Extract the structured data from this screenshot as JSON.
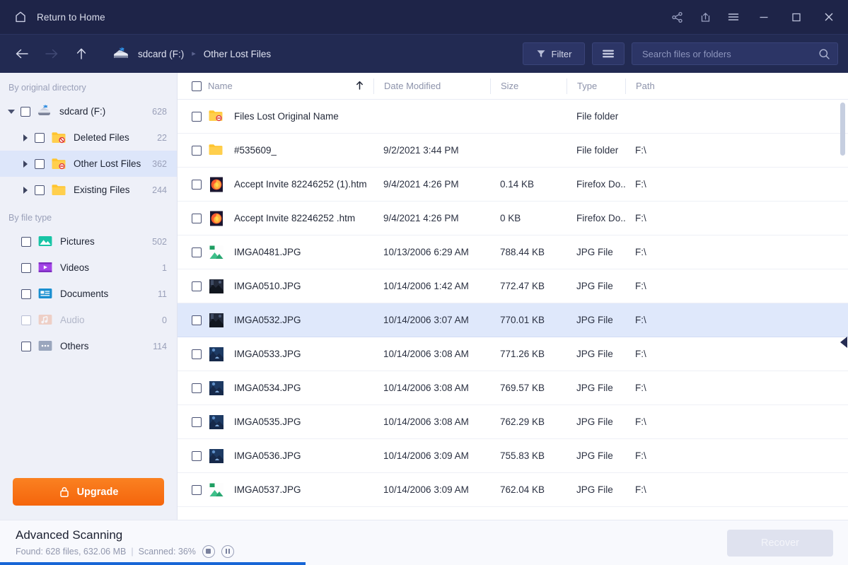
{
  "titlebar": {
    "home_label": "Return to Home",
    "home_icon": "home-icon",
    "buttons": [
      {
        "name": "share-icon",
        "label": "Share"
      },
      {
        "name": "export-icon",
        "label": "Export"
      },
      {
        "name": "menu-icon",
        "label": "Menu"
      },
      {
        "name": "minimize-icon",
        "label": "Minimize"
      },
      {
        "name": "maximize-icon",
        "label": "Maximize"
      },
      {
        "name": "close-icon",
        "label": "Close"
      }
    ]
  },
  "navbar": {
    "back_icon": "back-arrow-icon",
    "forward_icon": "forward-arrow-icon",
    "up_icon": "up-arrow-icon",
    "drive_icon": "drive-icon",
    "breadcrumb": {
      "root": "sdcard (F:)",
      "separator": "▸",
      "current": "Other Lost Files"
    },
    "filter_label": "Filter",
    "filter_icon": "funnel-icon",
    "view_icon": "list-view-icon",
    "search": {
      "placeholder": "Search files or folders",
      "value": "",
      "icon": "search-icon"
    }
  },
  "sidebar": {
    "section_directory": "By original directory",
    "section_filetype": "By file type",
    "tree": [
      {
        "label": "sdcard (F:)",
        "count": "628",
        "icon": "drive-icon",
        "level": 0,
        "expanded": true,
        "selected": false,
        "dim": false
      },
      {
        "label": "Deleted Files",
        "count": "22",
        "icon": "folder-deleted-icon",
        "level": 1,
        "expanded": false,
        "selected": false,
        "dim": false
      },
      {
        "label": "Other Lost Files",
        "count": "362",
        "icon": "folder-lost-icon",
        "level": 1,
        "expanded": false,
        "selected": true,
        "dim": false
      },
      {
        "label": "Existing Files",
        "count": "244",
        "icon": "folder-icon",
        "level": 1,
        "expanded": false,
        "selected": false,
        "dim": false
      }
    ],
    "filetypes": [
      {
        "label": "Pictures",
        "count": "502",
        "icon": "pictures-icon",
        "dim": false
      },
      {
        "label": "Videos",
        "count": "1",
        "icon": "videos-icon",
        "dim": false
      },
      {
        "label": "Documents",
        "count": "11",
        "icon": "documents-icon",
        "dim": false
      },
      {
        "label": "Audio",
        "count": "0",
        "icon": "audio-icon",
        "dim": true
      },
      {
        "label": "Others",
        "count": "114",
        "icon": "others-icon",
        "dim": false
      }
    ],
    "upgrade_label": "Upgrade",
    "upgrade_icon": "lock-icon"
  },
  "filelist": {
    "columns": {
      "name": "Name",
      "date": "Date Modified",
      "size": "Size",
      "type": "Type",
      "path": "Path"
    },
    "sort_icon": "sort-ascending-icon",
    "rows": [
      {
        "name": "Files Lost Original Name",
        "date": "",
        "size": "",
        "type": "File folder",
        "path": "",
        "icon": "folder-lost-icon",
        "selected": false
      },
      {
        "name": "#535609_",
        "date": "9/2/2021 3:44 PM",
        "size": "",
        "type": "File folder",
        "path": "F:\\",
        "icon": "folder-icon",
        "selected": false
      },
      {
        "name": "Accept Invite 82246252 (1).htm",
        "date": "9/4/2021 4:26 PM",
        "size": "0.14 KB",
        "type": "Firefox Do...",
        "path": "F:\\",
        "icon": "firefox-doc-icon",
        "selected": false
      },
      {
        "name": "Accept Invite 82246252 .htm",
        "date": "9/4/2021 4:26 PM",
        "size": "0 KB",
        "type": "Firefox Do...",
        "path": "F:\\",
        "icon": "firefox-doc-icon",
        "selected": false
      },
      {
        "name": "IMGA0481.JPG",
        "date": "10/13/2006 6:29 AM",
        "size": "788.44 KB",
        "type": "JPG File",
        "path": "F:\\",
        "icon": "image-green-icon",
        "selected": false
      },
      {
        "name": "IMGA0510.JPG",
        "date": "10/14/2006 1:42 AM",
        "size": "772.47 KB",
        "type": "JPG File",
        "path": "F:\\",
        "icon": "thumbnail-dark-icon",
        "selected": false
      },
      {
        "name": "IMGA0532.JPG",
        "date": "10/14/2006 3:07 AM",
        "size": "770.01 KB",
        "type": "JPG File",
        "path": "F:\\",
        "icon": "thumbnail-dark-icon",
        "selected": true
      },
      {
        "name": "IMGA0533.JPG",
        "date": "10/14/2006 3:08 AM",
        "size": "771.26 KB",
        "type": "JPG File",
        "path": "F:\\",
        "icon": "thumbnail-blue-icon",
        "selected": false
      },
      {
        "name": "IMGA0534.JPG",
        "date": "10/14/2006 3:08 AM",
        "size": "769.57 KB",
        "type": "JPG File",
        "path": "F:\\",
        "icon": "thumbnail-blue-icon",
        "selected": false
      },
      {
        "name": "IMGA0535.JPG",
        "date": "10/14/2006 3:08 AM",
        "size": "762.29 KB",
        "type": "JPG File",
        "path": "F:\\",
        "icon": "thumbnail-blue-icon",
        "selected": false
      },
      {
        "name": "IMGA0536.JPG",
        "date": "10/14/2006 3:09 AM",
        "size": "755.83 KB",
        "type": "JPG File",
        "path": "F:\\",
        "icon": "thumbnail-blue-icon",
        "selected": false
      },
      {
        "name": "IMGA0537.JPG",
        "date": "10/14/2006 3:09 AM",
        "size": "762.04 KB",
        "type": "JPG File",
        "path": "F:\\",
        "icon": "image-green-icon",
        "selected": false
      }
    ]
  },
  "statusbar": {
    "title": "Advanced Scanning",
    "found_text": "Found: 628 files, 632.06 MB",
    "separator": "|",
    "scanned_text": "Scanned: 36%",
    "progress_percent": 36,
    "stop_icon": "stop-icon",
    "pause_icon": "pause-icon",
    "recover_label": "Recover"
  },
  "colors": {
    "titlebar_bg": "#1e2448",
    "navbar_bg": "#222a52",
    "sidebar_bg": "#eef0f8",
    "selection_blue": "#dfe8fb",
    "accent_orange": "#f5650c",
    "progress_blue": "#1766d6"
  }
}
